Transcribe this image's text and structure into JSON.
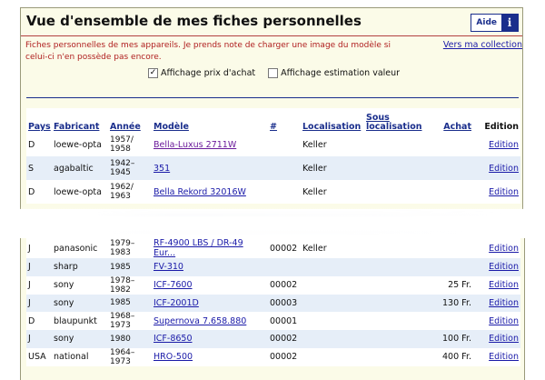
{
  "header": {
    "title": "Vue d'ensemble de mes fiches personnelles",
    "help_label": "Aide",
    "help_icon": "i"
  },
  "intro_text": "Fiches personnelles de mes appareils. Je prends note de charger une image du modèle si celui-ci n'en possède pas encore.",
  "collection_link": "Vers ma collection",
  "options": [
    {
      "label": "Affichage prix d'achat",
      "checked": true
    },
    {
      "label": "Affichage estimation valeur",
      "checked": false
    }
  ],
  "table": {
    "headers": {
      "pays": "Pays",
      "fabricant": "Fabricant",
      "annee": "Année",
      "modele": "Modèle",
      "num": "#",
      "loc": "Localisation",
      "sousloc": "Sous localisation",
      "achat": "Achat",
      "edition": "Edition"
    },
    "rows_top": [
      {
        "pays": "D",
        "fab": "loewe-opta",
        "annee": "1957/ 1958",
        "modele": "Bella-Luxus 2711W",
        "num": "",
        "loc": "Keller",
        "achat": "",
        "ed": "Edition",
        "visited": true
      },
      {
        "pays": "S",
        "fab": "agabaltic",
        "annee": "1942– 1945",
        "modele": "351",
        "num": "",
        "loc": "Keller",
        "achat": "",
        "ed": "Edition",
        "visited": false
      },
      {
        "pays": "D",
        "fab": "loewe-opta",
        "annee": "1962/ 1963",
        "modele": "Bella Rekord 32016W",
        "num": "",
        "loc": "Keller",
        "achat": "",
        "ed": "Edition",
        "visited": false
      }
    ],
    "rows_bottom": [
      {
        "pays": "J",
        "fab": "panasonic",
        "annee": "1979– 1983",
        "modele": "RF-4900 LBS / DR-49 Eur...",
        "num": "00002",
        "loc": "Keller",
        "achat": "",
        "ed": "Edition"
      },
      {
        "pays": "J",
        "fab": "sharp",
        "annee": "1985",
        "modele": "FV-310",
        "num": "",
        "loc": "",
        "achat": "",
        "ed": "Edition"
      },
      {
        "pays": "J",
        "fab": "sony",
        "annee": "1978– 1982",
        "modele": "ICF-7600",
        "num": "00002",
        "loc": "",
        "achat": "25 Fr.",
        "ed": "Edition"
      },
      {
        "pays": "J",
        "fab": "sony",
        "annee": "1985",
        "modele": "ICF-2001D",
        "num": "00003",
        "loc": "",
        "achat": "130 Fr.",
        "ed": "Edition"
      },
      {
        "pays": "D",
        "fab": "blaupunkt",
        "annee": "1968– 1973",
        "modele": "Supernova 7.658.880",
        "num": "00001",
        "loc": "",
        "achat": "",
        "ed": "Edition"
      },
      {
        "pays": "J",
        "fab": "sony",
        "annee": "1980",
        "modele": "ICF-8650",
        "num": "00002",
        "loc": "",
        "achat": "100 Fr.",
        "ed": "Edition"
      },
      {
        "pays": "USA",
        "fab": "national",
        "annee": "1964– 1973",
        "modele": "HRO-500",
        "num": "00002",
        "loc": "",
        "achat": "400 Fr.",
        "ed": "Edition"
      }
    ]
  }
}
